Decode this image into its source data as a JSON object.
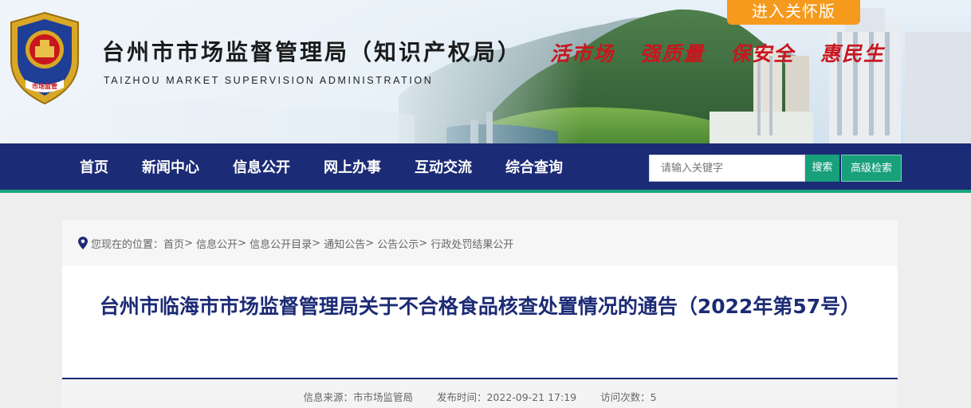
{
  "header": {
    "care_mode_label": "进入关怀版",
    "site_title": "台州市市场监督管理局（知识产权局）",
    "site_subtitle": "TAIZHOU MARKET SUPERVISION ADMINISTRATION",
    "emblem_text": "市场监管",
    "slogans": [
      "活市场",
      "强质量",
      "保安全",
      "惠民生"
    ]
  },
  "nav": {
    "items": [
      "首页",
      "新闻中心",
      "信息公开",
      "网上办事",
      "互动交流",
      "综合查询"
    ],
    "search_placeholder": "请输入关键字",
    "search_label": "搜索",
    "advanced_search_label": "高级检索"
  },
  "breadcrumb": {
    "prefix": "您现在的位置：",
    "items": [
      "首页",
      "信息公开",
      "信息公开目录",
      "通知公告",
      "公告公示",
      "行政处罚结果公开"
    ],
    "separator": ">"
  },
  "article": {
    "title": "台州市临海市市场监督管理局关于不合格食品核查处置情况的通告（2022年第57号）",
    "source": "信息来源：市市场监管局",
    "publish_time": "发布时间：2022-09-21 17:19",
    "visits": "访问次数：5"
  },
  "colors": {
    "nav_bg": "#1c2b75",
    "accent_green": "#17a07a",
    "care_orange": "#f59a1d",
    "slogan_red": "#c8161d",
    "title_blue": "#1c2b75"
  }
}
